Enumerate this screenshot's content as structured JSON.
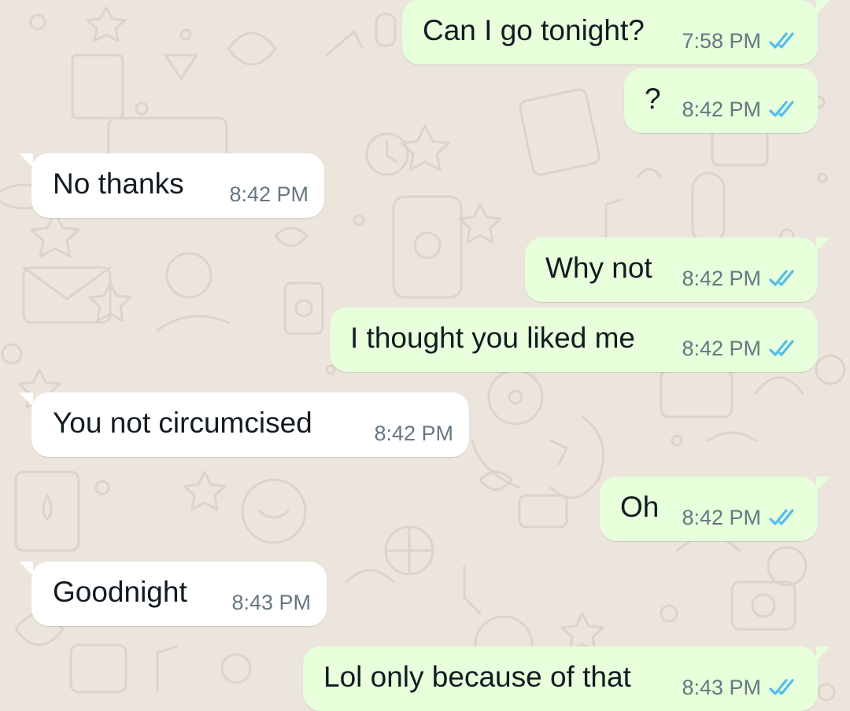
{
  "colors": {
    "background": "#ece5dd",
    "outgoing_bubble": "#e7ffdb",
    "incoming_bubble": "#ffffff",
    "text": "#111b21",
    "timestamp": "#667781",
    "read_ticks": "#53bdeb"
  },
  "icons": {
    "read_receipt": "double-check-icon"
  },
  "messages": [
    {
      "direction": "out",
      "text": "Can I go tonight?",
      "time": "7:58 PM",
      "status": "read"
    },
    {
      "direction": "out",
      "text": "?",
      "time": "8:42 PM",
      "status": "read"
    },
    {
      "direction": "in",
      "text": "No thanks",
      "time": "8:42 PM"
    },
    {
      "direction": "out",
      "text": "Why not",
      "time": "8:42 PM",
      "status": "read"
    },
    {
      "direction": "out",
      "text": "I thought you liked me",
      "time": "8:42 PM",
      "status": "read"
    },
    {
      "direction": "in",
      "text": "You not circumcised",
      "time": "8:42 PM"
    },
    {
      "direction": "out",
      "text": "Oh",
      "time": "8:42 PM",
      "status": "read"
    },
    {
      "direction": "in",
      "text": "Goodnight",
      "time": "8:43 PM"
    },
    {
      "direction": "out",
      "text": "Lol only because of that",
      "time": "8:43 PM",
      "status": "read"
    }
  ]
}
